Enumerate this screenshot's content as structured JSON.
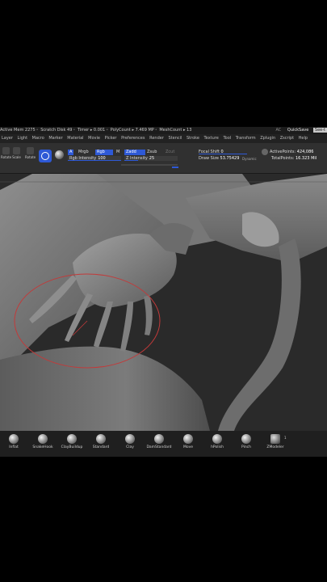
{
  "titlebar": {
    "stats": [
      "Active Mem 2275",
      "Scratch Disk 49",
      "Timer ▸ 0.001",
      "PolyCount ▸ 7.469 MP",
      "MeshCount ▸ 13"
    ],
    "ac": "AC",
    "quicksave": "QuickSave",
    "see_through": "See-t"
  },
  "menubar": [
    "Layer",
    "Light",
    "Macro",
    "Marker",
    "Material",
    "Movie",
    "Picker",
    "Preferences",
    "Render",
    "Stencil",
    "Stroke",
    "Texture",
    "Tool",
    "Transform",
    "Zplugin",
    "Zscript",
    "Help"
  ],
  "shelf": {
    "tools": [
      {
        "label": "Rotate"
      },
      {
        "label": "Scale"
      },
      {
        "label": "Rotate"
      }
    ],
    "a_label": "A",
    "mrgb_label": "Mrgb",
    "rgb_label": "Rgb",
    "m_label": "M",
    "zadd_label": "Zadd",
    "zsub_label": "Zsub",
    "zcut_label": "Zcut",
    "rgb_intensity_label": "Rgb Intensity",
    "rgb_intensity_value": "100",
    "z_intensity_label": "Z Intensity",
    "z_intensity_value": "25",
    "focal_shift_label": "Focal Shift",
    "focal_shift_value": "0",
    "draw_size_label": "Draw Size",
    "draw_size_value": "53.75429",
    "dynamic_label": "Dynamic",
    "active_points_label": "ActivePoints:",
    "active_points_value": "424,086",
    "total_points_label": "TotalPoints:",
    "total_points_value": "16.323 Mil"
  },
  "palette": {
    "brushes": [
      {
        "label": "Inflat"
      },
      {
        "label": "SnakeHook"
      },
      {
        "label": "ClayBuildup"
      },
      {
        "label": "Standard"
      },
      {
        "label": "Clay"
      },
      {
        "label": "DamStandard"
      },
      {
        "label": "Move"
      },
      {
        "label": "hPolish"
      },
      {
        "label": "Pinch"
      },
      {
        "label": "ZModeler"
      }
    ],
    "count": "1"
  },
  "colors": {
    "accent": "#2e59d6",
    "brush_circle": "#c23a3a",
    "background": "#2a2a2a"
  }
}
